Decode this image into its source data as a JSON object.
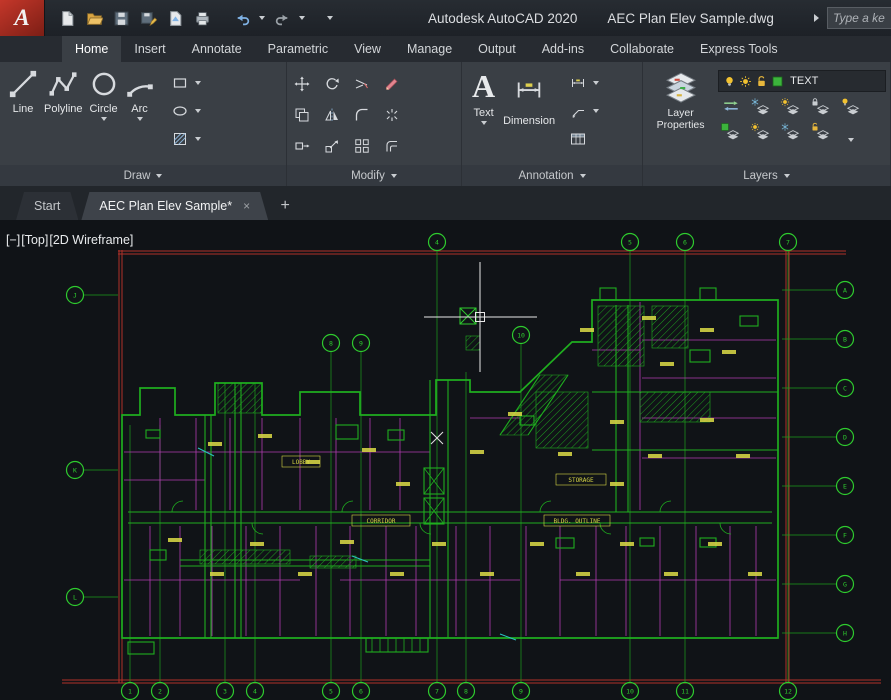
{
  "titlebar": {
    "logo": "A",
    "product": "Autodesk AutoCAD 2020",
    "document": "AEC Plan Elev Sample.dwg",
    "search_placeholder": "Type a ke",
    "icons": [
      "new-file",
      "open",
      "save",
      "save-as",
      "publish",
      "plot",
      "undo",
      "redo",
      "toolbar-menu",
      "search"
    ]
  },
  "ribbon_tabs": [
    {
      "label": "Home",
      "active": true
    },
    {
      "label": "Insert"
    },
    {
      "label": "Annotate"
    },
    {
      "label": "Parametric"
    },
    {
      "label": "View"
    },
    {
      "label": "Manage"
    },
    {
      "label": "Output"
    },
    {
      "label": "Add-ins"
    },
    {
      "label": "Collaborate"
    },
    {
      "label": "Express Tools"
    }
  ],
  "panels": {
    "draw": {
      "label": "Draw",
      "line": "Line",
      "polyline": "Polyline",
      "circle": "Circle",
      "arc": "Arc"
    },
    "modify": {
      "label": "Modify"
    },
    "annotation": {
      "label": "Annotation",
      "text_icon": "A",
      "text": "Text",
      "dimension": "Dimension"
    },
    "layers": {
      "label": "Layers",
      "big_label_1": "Layer",
      "big_label_2": "Properties",
      "current_layer": "TEXT"
    }
  },
  "file_tabs": {
    "start": "Start",
    "doc": "AEC Plan Elev Sample*",
    "close": "×",
    "new": "+"
  },
  "viewport_controls": {
    "minus": "[−]",
    "view": "[Top]",
    "visual_style": "[2D Wireframe]"
  },
  "canvas_labels": {
    "lobby": "LOBBY",
    "corridor": "CORRIDOR",
    "storage": "STORAGE",
    "outline": "BLDG. OUTLINE"
  },
  "grid_bubbles": {
    "top": [
      "4",
      "5",
      "6",
      "7"
    ],
    "inner": [
      "8",
      "9",
      "10"
    ],
    "right": [
      "A",
      "B",
      "C",
      "D",
      "E",
      "F",
      "G",
      "H"
    ],
    "bottom": [
      "1",
      "2",
      "3",
      "4",
      "5",
      "6",
      "7",
      "8",
      "9",
      "10",
      "11",
      "12"
    ],
    "left": [
      "J",
      "K",
      "L"
    ]
  }
}
